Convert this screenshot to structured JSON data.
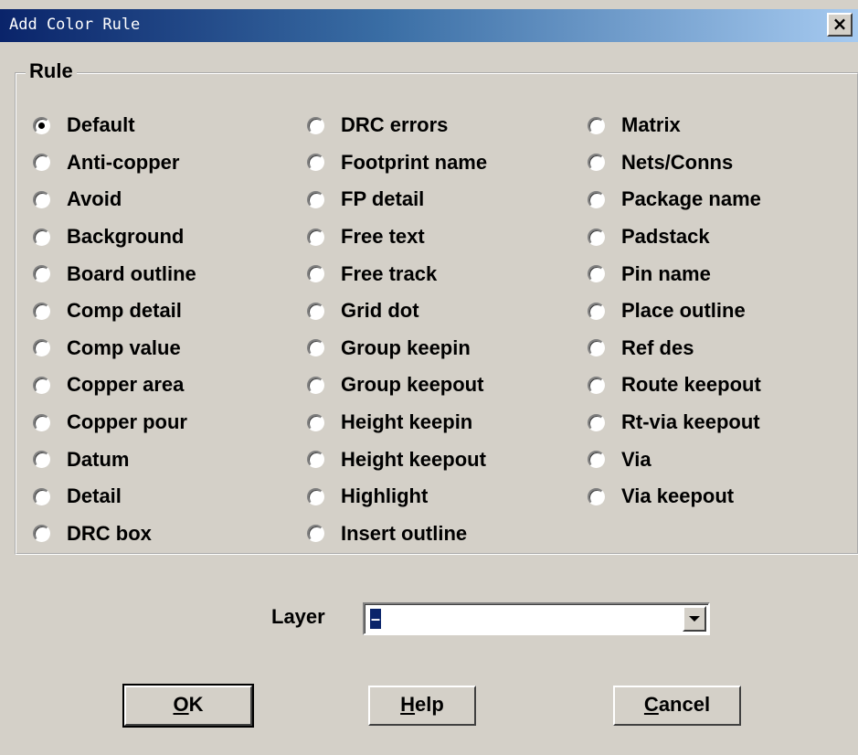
{
  "window": {
    "title": "Add Color Rule",
    "close_label": "×"
  },
  "rule_group": {
    "label": "Rule",
    "selected": "Default",
    "columns": [
      [
        "Default",
        "Anti-copper",
        "Avoid",
        "Background",
        "Board outline",
        "Comp detail",
        "Comp value",
        "Copper area",
        "Copper pour",
        "Datum",
        "Detail",
        "DRC box"
      ],
      [
        "DRC errors",
        "Footprint name",
        "FP detail",
        "Free text",
        "Free track",
        "Grid dot",
        "Group keepin",
        "Group keepout",
        "Height keepin",
        "Height keepout",
        "Highlight",
        "Insert outline"
      ],
      [
        "Matrix",
        "Nets/Conns",
        "Package name",
        "Padstack",
        "Pin name",
        "Place outline",
        "Ref des",
        "Route keepout",
        "Rt-via keepout",
        "Via",
        "Via keepout"
      ]
    ]
  },
  "layer": {
    "label": "Layer",
    "value": "–"
  },
  "buttons": {
    "ok": {
      "mnemonic": "O",
      "rest": "K"
    },
    "help": {
      "mnemonic": "H",
      "rest": "elp"
    },
    "cancel": {
      "mnemonic": "C",
      "rest": "ancel"
    }
  }
}
